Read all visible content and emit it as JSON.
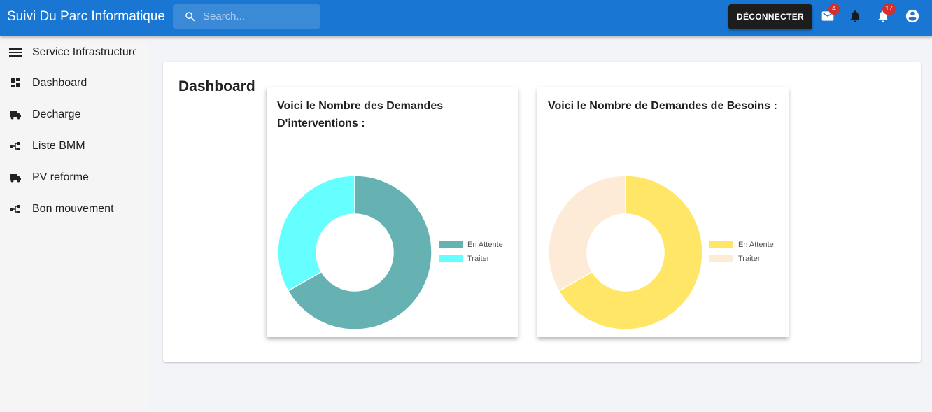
{
  "header": {
    "title": "Suivi Du Parc Informatique",
    "search_placeholder": "Search...",
    "logout_label": "DÉCONNECTER",
    "mail_badge": "4",
    "notifications_badge": "17"
  },
  "sidebar": {
    "items": [
      {
        "label": "Service Infrastructure",
        "icon": "menu-icon"
      },
      {
        "label": "Dashboard",
        "icon": "dashboard-icon"
      },
      {
        "label": "Decharge",
        "icon": "truck-icon"
      },
      {
        "label": "Liste BMM",
        "icon": "account-tree-icon"
      },
      {
        "label": "PV reforme",
        "icon": "truck-icon"
      },
      {
        "label": "Bon mouvement",
        "icon": "account-tree-icon"
      }
    ]
  },
  "main": {
    "title": "Dashboard",
    "cards": [
      {
        "title": "Voici le Nombre des Demandes D'interventions :",
        "chart_data": {
          "type": "pie",
          "variant": "doughnut",
          "legend_position": "right",
          "title": "",
          "labels": [
            "En Attente",
            "Traiter"
          ],
          "values": [
            2,
            1
          ],
          "colors": [
            "#66b2b2",
            "#66ffff"
          ]
        }
      },
      {
        "title": "Voici le Nombre de Demandes de Besoins :",
        "chart_data": {
          "type": "pie",
          "variant": "doughnut",
          "legend_position": "right",
          "title": "",
          "labels": [
            "En Attente",
            "Traiter"
          ],
          "values": [
            2,
            1
          ],
          "colors": [
            "#ffe666",
            "#fdebd8"
          ]
        }
      }
    ]
  }
}
